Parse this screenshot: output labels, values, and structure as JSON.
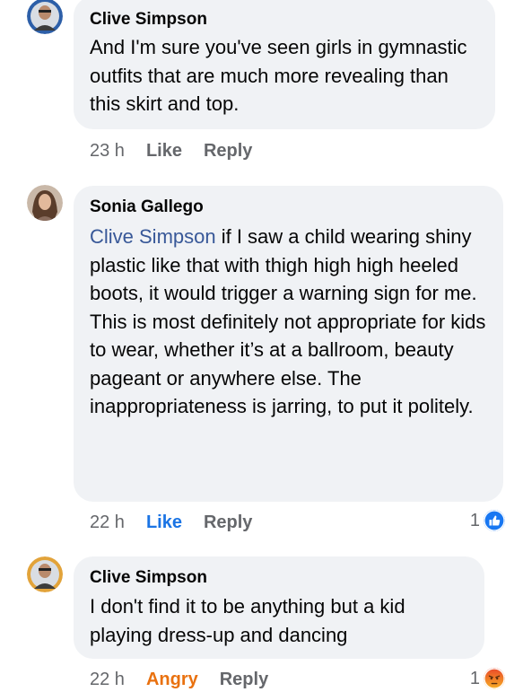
{
  "comments": [
    {
      "author": "Clive Simpson",
      "mention": "",
      "text": "And I'm sure you've seen girls in gymnastic outfits that are much more revealing than this skirt and top.",
      "time": "23 h",
      "reaction_label": "Like",
      "reply_label": "Reply",
      "reaction_count": ""
    },
    {
      "author": "Sonia Gallego",
      "mention": "Clive Simpson",
      "text": " if I saw a child wearing shiny plastic like that with thigh high high heeled boots, it would trigger a warning sign for me. This is most definitely not appropriate for kids to wear, whether it’s at a ballroom, beauty pageant or anywhere else. The inappropriateness is jarring, to put it politely.",
      "time": "22 h",
      "reaction_label": "Like",
      "reply_label": "Reply",
      "reaction_count": "1",
      "reaction_icon": "like-reaction-icon"
    },
    {
      "author": "Clive Simpson",
      "mention": "",
      "text": "I don't find it to be anything but a kid playing dress-up and dancing",
      "time": "22 h",
      "reaction_label": "Angry",
      "reply_label": "Reply",
      "reaction_count": "1",
      "reaction_icon": "angry-reaction-icon"
    }
  ],
  "colors": {
    "bubble": "#f0f2f5",
    "mention": "#385898",
    "like_active": "#1b74e4",
    "angry_active": "#e9710f"
  }
}
